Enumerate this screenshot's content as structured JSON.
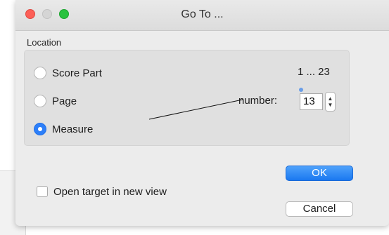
{
  "window": {
    "title": "Go To ..."
  },
  "location_group": {
    "label": "Location",
    "options": [
      {
        "label": "Score Part",
        "checked": false
      },
      {
        "label": "Page",
        "checked": false
      },
      {
        "label": "Measure",
        "checked": true
      }
    ],
    "range_text": "1 ... 23",
    "number_label": "number:",
    "number_value": "13",
    "stepper_up": "▲",
    "stepper_down": "▼"
  },
  "open_new_view": {
    "label": "Open target in new view",
    "checked": false
  },
  "buttons": {
    "ok": "OK",
    "cancel": "Cancel"
  },
  "colors": {
    "accent": "#2d7ff9",
    "close": "#fc5f57",
    "zoom": "#29c23f"
  }
}
